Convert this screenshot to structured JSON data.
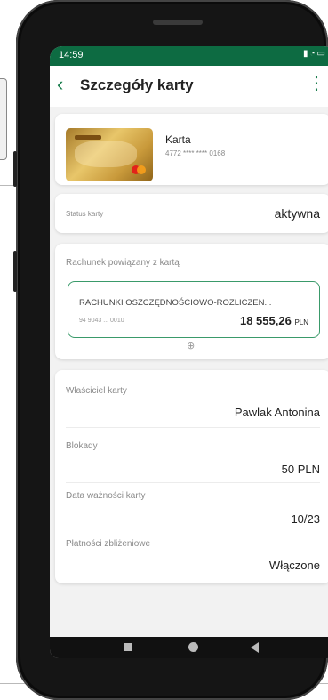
{
  "status_bar": {
    "time": "14:59",
    "icons": "▮◔▭"
  },
  "header": {
    "back_icon": "‹",
    "title": "Szczegóły karty",
    "menu_icon": "⋮"
  },
  "card": {
    "name": "Karta",
    "number": "4772 **** **** 0168"
  },
  "status": {
    "label": "Status karty",
    "value": "aktywna"
  },
  "account": {
    "heading": "Rachunek powiązany z kartą",
    "name": "RACHUNKI OSZCZĘDNOŚCIOWO-ROZLICZEN...",
    "number": "94 9043 ... 0010",
    "balance": "18 555,26",
    "currency": "PLN",
    "more_icon": "⊕"
  },
  "details": [
    {
      "label": "Właściciel karty",
      "value": "Pawlak Antonina"
    },
    {
      "label": "Blokady",
      "value": "50 PLN"
    },
    {
      "label": "Data ważności karty",
      "value": "10/23"
    },
    {
      "label": "Płatności zbliżeniowe",
      "value": "Włączone"
    }
  ],
  "colors": {
    "accent": "#1a7d4d",
    "statusbar": "#0d6b42",
    "account_border": "#3a9a6a"
  }
}
